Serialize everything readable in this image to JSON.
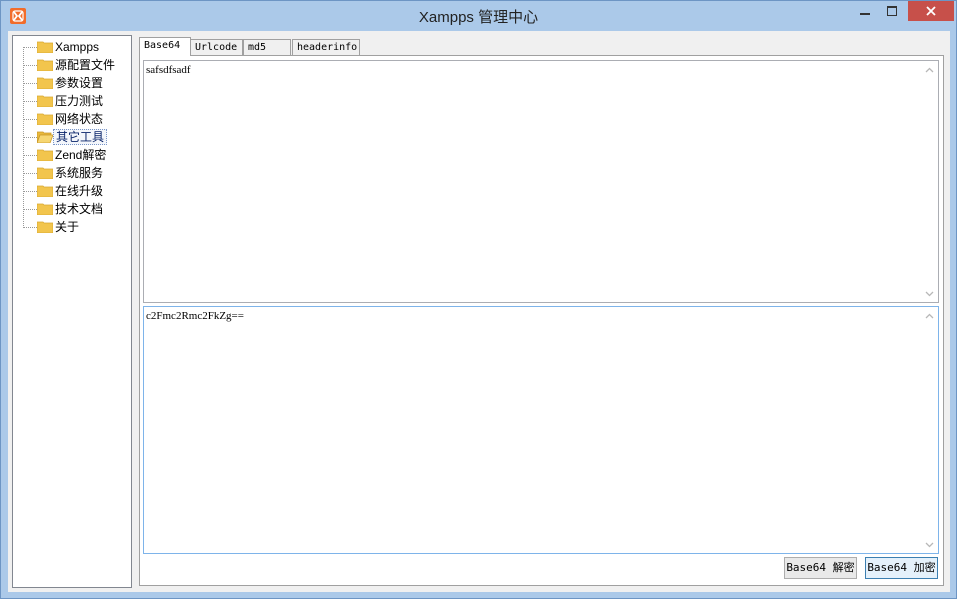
{
  "window": {
    "title": "Xampps 管理中心"
  },
  "tree": {
    "items": [
      {
        "label": "Xampps"
      },
      {
        "label": "源配置文件"
      },
      {
        "label": "参数设置"
      },
      {
        "label": "压力测试"
      },
      {
        "label": "网络状态"
      },
      {
        "label": "其它工具"
      },
      {
        "label": "Zend解密"
      },
      {
        "label": "系统服务"
      },
      {
        "label": "在线升级"
      },
      {
        "label": "技术文档"
      },
      {
        "label": "关于"
      }
    ],
    "selected": "其它工具"
  },
  "tabs": [
    {
      "label": "Base64"
    },
    {
      "label": "Urlcode"
    },
    {
      "label": "md5"
    },
    {
      "label": "headerinfo"
    }
  ],
  "active_tab": "Base64",
  "base64": {
    "input_text": "safsdfsadf",
    "output_text": "c2Fmc2Rmc2FkZg==",
    "decode_label": "Base64 解密",
    "encode_label": "Base64 加密"
  },
  "colors": {
    "titlebar": "#abc9e9",
    "close_button": "#c7504a",
    "folder": "#f2c54d"
  }
}
